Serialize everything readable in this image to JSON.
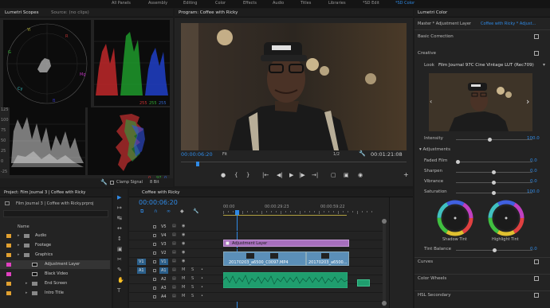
{
  "topnav": {
    "items": [
      {
        "label": "All Panels",
        "active": false
      },
      {
        "label": "Assembly",
        "active": false
      },
      {
        "label": "Editing",
        "active": false
      },
      {
        "label": "Color",
        "active": false
      },
      {
        "label": "Effects",
        "active": false
      },
      {
        "label": "Audio",
        "active": false
      },
      {
        "label": "Titles",
        "active": false
      },
      {
        "label": "Libraries",
        "active": false
      },
      {
        "label": "*SD Edit",
        "active": false
      },
      {
        "label": "*SD Color",
        "active": true
      }
    ]
  },
  "scopes": {
    "tab": "Lumetri Scopes",
    "source_tab": "Source: (no clips)",
    "ticks_left": [
      "125",
      "100",
      "75",
      "50",
      "25",
      "0",
      "-25"
    ],
    "rgb_vals": [
      "255",
      "255",
      "255"
    ],
    "bottom_vals": [
      "0",
      "97",
      "0"
    ],
    "clamp_label": "Clamp Signal",
    "bit_depth": "8 Bit"
  },
  "program": {
    "title": "Program: Coffee with Ricky",
    "timecode": "00:00:06:20",
    "fit": "Fit",
    "fraction": "1/2",
    "duration": "00:01:21:08"
  },
  "lumetri": {
    "title": "Lumetri Color",
    "master": "Master * Adjustment Layer",
    "clip": "Coffee with Ricky * Adjust...",
    "basic": "Basic Correction",
    "creative": "Creative",
    "look_label": "Look",
    "look_value": "Film Journal 97C Cine Vintage LUT (Rec709)",
    "intensity_label": "Intensity",
    "intensity_value": "100.0",
    "adjustments": "Adjustments",
    "sliders": [
      {
        "label": "Faded Film",
        "value": "0.0",
        "pos": 0
      },
      {
        "label": "Sharpen",
        "value": "0.0",
        "pos": 0.5
      },
      {
        "label": "Vibrance",
        "value": "0.0",
        "pos": 0.5
      },
      {
        "label": "Saturation",
        "value": "100.0",
        "pos": 0.5
      }
    ],
    "shadow_tint": "Shadow Tint",
    "highlight_tint": "Highlight Tint",
    "tint_balance_label": "Tint Balance",
    "tint_balance_value": "0.0",
    "sections": [
      "Curves",
      "Color Wheels",
      "HSL Secondary"
    ]
  },
  "project": {
    "title": "Project: Film Journal 3 | Coffee with Ricky",
    "file": "Film Journal 3 | Coffee with Ricky.prproj",
    "name_header": "Name",
    "items": [
      {
        "label": "Audio",
        "color": "#e0a030",
        "indent": 0,
        "type": "bin"
      },
      {
        "label": "Footage",
        "color": "#e0a030",
        "indent": 0,
        "type": "bin"
      },
      {
        "label": "Graphics",
        "color": "#e0a030",
        "indent": 0,
        "type": "bin"
      },
      {
        "label": "Adjustment Layer",
        "color": "#e040c0",
        "indent": 1,
        "type": "clip"
      },
      {
        "label": "Black Video",
        "color": "#e040c0",
        "indent": 1,
        "type": "clip"
      },
      {
        "label": "End Screen",
        "color": "#e0a030",
        "indent": 1,
        "type": "bin"
      },
      {
        "label": "Intro Title",
        "color": "#e0a030",
        "indent": 1,
        "type": "bin"
      }
    ]
  },
  "timeline": {
    "title": "Coffee with Ricky",
    "timecode": "00:00:06:20",
    "ruler": [
      "00:00",
      "00:00:29:23",
      "00:00:59:22"
    ],
    "tracks": [
      {
        "label": "V5",
        "type": "video"
      },
      {
        "label": "V4",
        "type": "video"
      },
      {
        "label": "V3",
        "type": "video"
      },
      {
        "label": "V2",
        "type": "video"
      },
      {
        "label": "V1",
        "type": "video",
        "source": "V1"
      },
      {
        "label": "A1",
        "type": "audio",
        "source": "A1"
      },
      {
        "label": "A2",
        "type": "audio"
      },
      {
        "label": "A3",
        "type": "audio"
      },
      {
        "label": "A4",
        "type": "audio"
      }
    ],
    "adj_clip": "Adjustment Layer",
    "clip1": "20170203_a6500_C0097.MP4",
    "clip2": "20170203_a6500..."
  }
}
